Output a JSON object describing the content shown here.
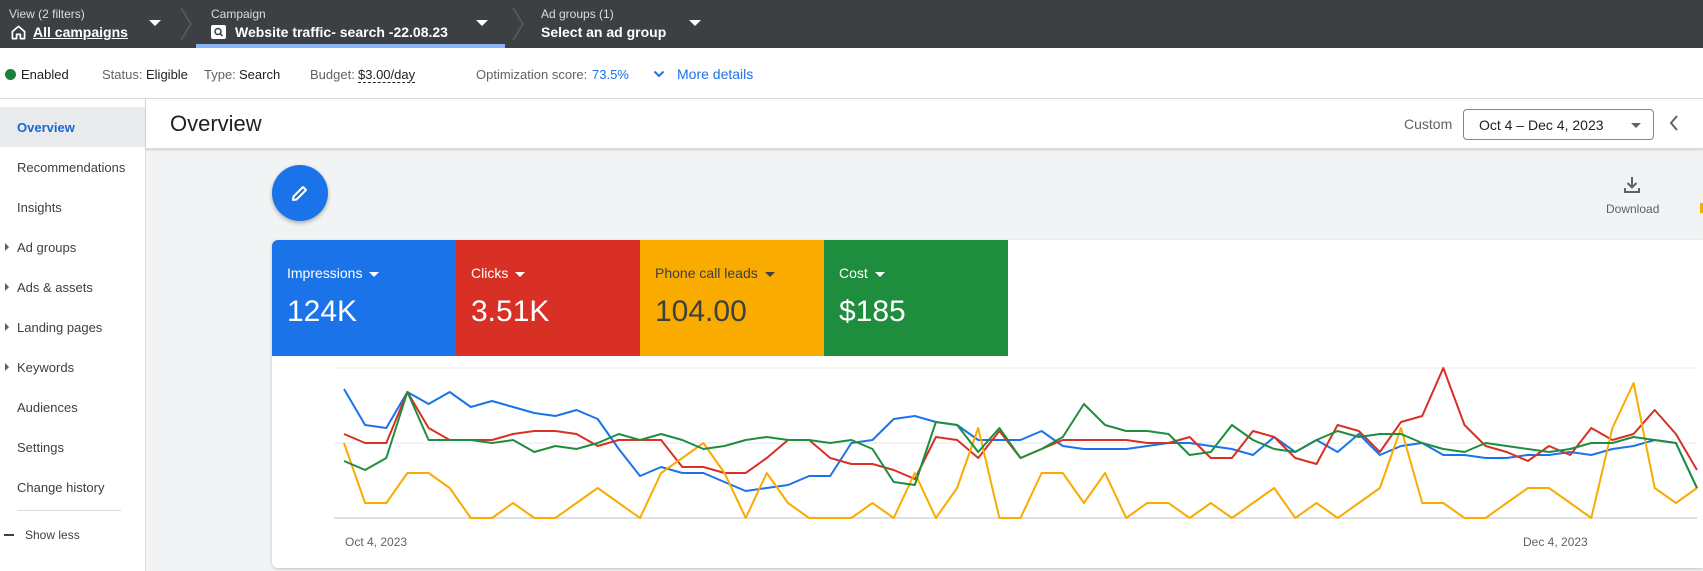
{
  "topbar": {
    "view_label": "View (2 filters)",
    "view_value": "All campaigns",
    "campaign_label": "Campaign",
    "campaign_value": "Website traffic- search -22.08.23",
    "adgroups_label": "Ad groups (1)",
    "adgroups_value": "Select an ad group"
  },
  "status": {
    "enabled": "Enabled",
    "status_label": "Status:",
    "status_value": "Eligible",
    "type_label": "Type:",
    "type_value": "Search",
    "budget_label": "Budget:",
    "budget_value": "$3.00/day",
    "opt_label": "Optimization score:",
    "opt_value": "73.5%",
    "more_details": "More details",
    "enabled_color": "#188038"
  },
  "sidebar": {
    "items": [
      {
        "label": "Overview",
        "active": true,
        "expandable": false
      },
      {
        "label": "Recommendations",
        "active": false,
        "expandable": false
      },
      {
        "label": "Insights",
        "active": false,
        "expandable": false
      },
      {
        "label": "Ad groups",
        "active": false,
        "expandable": true
      },
      {
        "label": "Ads & assets",
        "active": false,
        "expandable": true
      },
      {
        "label": "Landing pages",
        "active": false,
        "expandable": true
      },
      {
        "label": "Keywords",
        "active": false,
        "expandable": true
      },
      {
        "label": "Audiences",
        "active": false,
        "expandable": false
      },
      {
        "label": "Settings",
        "active": false,
        "expandable": false
      },
      {
        "label": "Change history",
        "active": false,
        "expandable": false
      }
    ],
    "show_less": "Show less"
  },
  "header": {
    "title": "Overview",
    "custom_label": "Custom",
    "date_range": "Oct 4 – Dec 4, 2023"
  },
  "toolbar": {
    "download_label": "Download"
  },
  "metrics": {
    "impressions": {
      "label": "Impressions",
      "value": "124K",
      "color": "#1a73e8"
    },
    "clicks": {
      "label": "Clicks",
      "value": "3.51K",
      "color": "#d93025"
    },
    "phone": {
      "label": "Phone call leads",
      "value": "104.00",
      "color": "#f9ab00"
    },
    "cost": {
      "label": "Cost",
      "value": "$185",
      "color": "#1e8e3e"
    }
  },
  "chart_data": {
    "type": "line",
    "x_start": "Oct 4, 2023",
    "x_end": "Dec 4, 2023",
    "ylim": [
      0,
      100
    ],
    "grid": true,
    "series": [
      {
        "name": "Impressions",
        "color": "#1a73e8",
        "values": [
          86,
          62,
          60,
          84,
          76,
          84,
          74,
          78,
          74,
          70,
          68,
          72,
          66,
          46,
          28,
          34,
          30,
          30,
          24,
          18,
          20,
          22,
          28,
          28,
          50,
          52,
          66,
          68,
          64,
          62,
          52,
          52,
          52,
          58,
          48,
          46,
          46,
          46,
          48,
          50,
          50,
          48,
          46,
          42,
          54,
          44,
          52,
          44,
          56,
          42,
          48,
          50,
          42,
          42,
          40,
          40,
          42,
          42,
          44,
          42,
          46,
          48,
          52,
          50,
          20
        ]
      },
      {
        "name": "Clicks",
        "color": "#d93025",
        "values": [
          56,
          50,
          50,
          84,
          60,
          52,
          52,
          52,
          56,
          58,
          58,
          56,
          48,
          52,
          52,
          52,
          34,
          34,
          30,
          30,
          40,
          52,
          52,
          40,
          36,
          36,
          32,
          26,
          54,
          52,
          40,
          58,
          40,
          46,
          52,
          52,
          52,
          52,
          50,
          50,
          54,
          40,
          40,
          58,
          54,
          40,
          36,
          62,
          58,
          44,
          64,
          68,
          100,
          62,
          48,
          44,
          38,
          48,
          42,
          60,
          52,
          56,
          72,
          56,
          32
        ]
      },
      {
        "name": "Phone call leads",
        "color": "#f9ab00",
        "values": [
          50,
          10,
          10,
          30,
          30,
          20,
          0,
          0,
          10,
          0,
          0,
          10,
          20,
          10,
          0,
          30,
          40,
          50,
          30,
          0,
          30,
          10,
          0,
          0,
          0,
          10,
          0,
          30,
          0,
          20,
          60,
          0,
          0,
          30,
          30,
          10,
          30,
          0,
          10,
          10,
          0,
          10,
          0,
          10,
          20,
          0,
          10,
          0,
          10,
          20,
          60,
          10,
          10,
          0,
          0,
          10,
          20,
          20,
          10,
          0,
          60,
          90,
          20,
          10,
          20
        ]
      },
      {
        "name": "Cost",
        "color": "#1e8e3e",
        "values": [
          38,
          32,
          40,
          84,
          52,
          52,
          52,
          50,
          52,
          44,
          48,
          46,
          50,
          56,
          52,
          56,
          52,
          46,
          48,
          52,
          54,
          52,
          52,
          50,
          52,
          46,
          24,
          22,
          64,
          62,
          44,
          60,
          40,
          46,
          54,
          76,
          62,
          58,
          58,
          56,
          42,
          44,
          62,
          52,
          46,
          44,
          52,
          58,
          54,
          56,
          56,
          50,
          46,
          44,
          50,
          48,
          46,
          44,
          46,
          50,
          50,
          54,
          52,
          50,
          20
        ]
      }
    ]
  }
}
